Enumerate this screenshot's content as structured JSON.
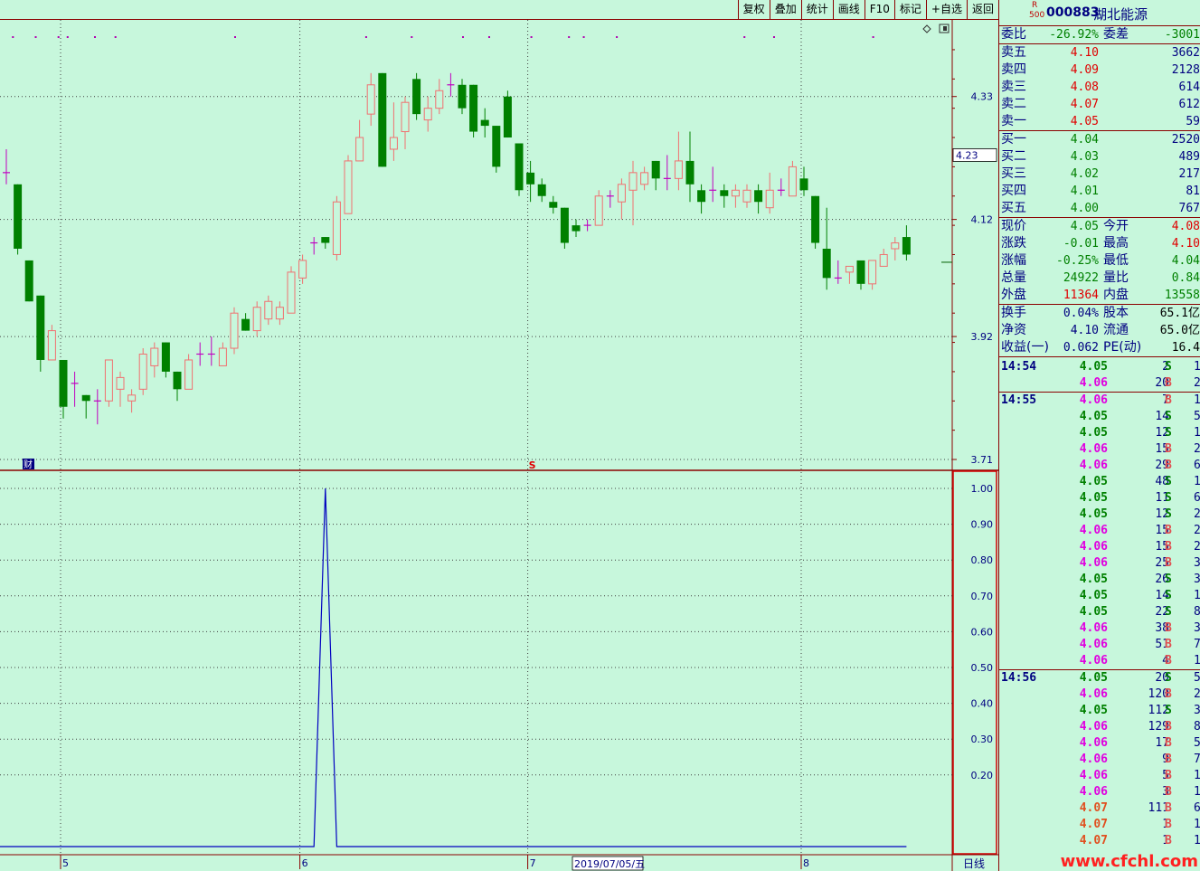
{
  "toolbar": {
    "buttons": [
      "复权",
      "叠加",
      "统计",
      "画线",
      "F10",
      "标记",
      "+自选",
      "返回"
    ]
  },
  "stock": {
    "marker_top": "R",
    "marker_bottom": "500",
    "code": "000883",
    "name": "湖北能源"
  },
  "order_book": {
    "ratio": {
      "label": "委比",
      "value": "-26.92%",
      "label2": "委差",
      "value2": "-3001"
    },
    "sells": [
      {
        "label": "卖五",
        "price": "4.10",
        "vol": "3662"
      },
      {
        "label": "卖四",
        "price": "4.09",
        "vol": "2128"
      },
      {
        "label": "卖三",
        "price": "4.08",
        "vol": "614"
      },
      {
        "label": "卖二",
        "price": "4.07",
        "vol": "612"
      },
      {
        "label": "卖一",
        "price": "4.05",
        "vol": "59"
      }
    ],
    "buys": [
      {
        "label": "买一",
        "price": "4.04",
        "vol": "2520"
      },
      {
        "label": "买二",
        "price": "4.03",
        "vol": "489"
      },
      {
        "label": "买三",
        "price": "4.02",
        "vol": "217"
      },
      {
        "label": "买四",
        "price": "4.01",
        "vol": "81"
      },
      {
        "label": "买五",
        "price": "4.00",
        "vol": "767"
      }
    ]
  },
  "quote": [
    {
      "l1": "现价",
      "v1": "4.05",
      "c1": "green",
      "l2": "今开",
      "v2": "4.08",
      "c2": "red"
    },
    {
      "l1": "涨跌",
      "v1": "-0.01",
      "c1": "green",
      "l2": "最高",
      "v2": "4.10",
      "c2": "red"
    },
    {
      "l1": "涨幅",
      "v1": "-0.25%",
      "c1": "green",
      "l2": "最低",
      "v2": "4.04",
      "c2": "green"
    },
    {
      "l1": "总量",
      "v1": "24922",
      "c1": "green",
      "l2": "量比",
      "v2": "0.84",
      "c2": "green"
    },
    {
      "l1": "外盘",
      "v1": "11364",
      "c1": "red",
      "l2": "内盘",
      "v2": "13558",
      "c2": "green"
    }
  ],
  "finance": [
    {
      "l1": "换手",
      "v1": "0.04%",
      "l2": "股本",
      "v2": "65.1亿"
    },
    {
      "l1": "净资",
      "v1": "4.10",
      "l2": "流通",
      "v2": "65.0亿"
    },
    {
      "l1": "收益(一)",
      "v1": "0.062",
      "l2": "PE(动)",
      "v2": "16.4"
    }
  ],
  "ticks": [
    {
      "time": "14:54",
      "price": "4.05",
      "vol": "2",
      "dir": "S",
      "cnt": "1"
    },
    {
      "time": "",
      "price": "4.06",
      "vol": "20",
      "dir": "B",
      "cnt": "2"
    },
    {
      "time": "14:55",
      "price": "4.06",
      "vol": "7",
      "dir": "B",
      "cnt": "1"
    },
    {
      "time": "",
      "price": "4.05",
      "vol": "14",
      "dir": "S",
      "cnt": "5"
    },
    {
      "time": "",
      "price": "4.05",
      "vol": "12",
      "dir": "S",
      "cnt": "1"
    },
    {
      "time": "",
      "price": "4.06",
      "vol": "15",
      "dir": "B",
      "cnt": "2"
    },
    {
      "time": "",
      "price": "4.06",
      "vol": "29",
      "dir": "B",
      "cnt": "6"
    },
    {
      "time": "",
      "price": "4.05",
      "vol": "48",
      "dir": "S",
      "cnt": "19"
    },
    {
      "time": "",
      "price": "4.05",
      "vol": "11",
      "dir": "S",
      "cnt": "6"
    },
    {
      "time": "",
      "price": "4.05",
      "vol": "12",
      "dir": "S",
      "cnt": "2"
    },
    {
      "time": "",
      "price": "4.06",
      "vol": "15",
      "dir": "B",
      "cnt": "2"
    },
    {
      "time": "",
      "price": "4.06",
      "vol": "15",
      "dir": "B",
      "cnt": "2"
    },
    {
      "time": "",
      "price": "4.06",
      "vol": "25",
      "dir": "B",
      "cnt": "3"
    },
    {
      "time": "",
      "price": "4.05",
      "vol": "26",
      "dir": "S",
      "cnt": "3"
    },
    {
      "time": "",
      "price": "4.05",
      "vol": "14",
      "dir": "S",
      "cnt": "1"
    },
    {
      "time": "",
      "price": "4.05",
      "vol": "22",
      "dir": "S",
      "cnt": "8"
    },
    {
      "time": "",
      "price": "4.06",
      "vol": "38",
      "dir": "B",
      "cnt": "3"
    },
    {
      "time": "",
      "price": "4.06",
      "vol": "51",
      "dir": "B",
      "cnt": "7"
    },
    {
      "time": "",
      "price": "4.06",
      "vol": "4",
      "dir": "B",
      "cnt": "1"
    },
    {
      "time": "14:56",
      "price": "4.05",
      "vol": "20",
      "dir": "S",
      "cnt": "5"
    },
    {
      "time": "",
      "price": "4.06",
      "vol": "120",
      "dir": "B",
      "cnt": "20"
    },
    {
      "time": "",
      "price": "4.05",
      "vol": "112",
      "dir": "S",
      "cnt": "3"
    },
    {
      "time": "",
      "price": "4.06",
      "vol": "129",
      "dir": "B",
      "cnt": "8"
    },
    {
      "time": "",
      "price": "4.06",
      "vol": "17",
      "dir": "B",
      "cnt": "5"
    },
    {
      "time": "",
      "price": "4.06",
      "vol": "9",
      "dir": "B",
      "cnt": "7"
    },
    {
      "time": "",
      "price": "4.06",
      "vol": "5",
      "dir": "B",
      "cnt": "1"
    },
    {
      "time": "",
      "price": "4.06",
      "vol": "3",
      "dir": "B",
      "cnt": "1"
    },
    {
      "time": "",
      "price": "4.07",
      "vol": "111",
      "dir": "B",
      "cnt": "6"
    },
    {
      "time": "",
      "price": "4.07",
      "vol": "1",
      "dir": "B",
      "cnt": "1"
    },
    {
      "time": "",
      "price": "4.07",
      "vol": "1",
      "dir": "B",
      "cnt": "1"
    }
  ],
  "colors": {
    "up": "#f07070",
    "down": "#008000",
    "doji": "#c000c0",
    "indicator": "#0000c0",
    "grid": "#404040",
    "frame": "#8b0000",
    "cursor_box": "#d00000"
  },
  "chart_data": {
    "type": "candlestick",
    "price_axis": {
      "ticks": [
        "4.33",
        "4.12",
        "3.92",
        "3.71"
      ],
      "ylim": [
        3.71,
        4.43
      ],
      "current_label": "4.23"
    },
    "indicator_axis": {
      "ticks": [
        "1.00",
        "0.90",
        "0.80",
        "0.70",
        "0.60",
        "0.50",
        "0.40",
        "0.30",
        "0.20"
      ],
      "ylim": [
        0.0,
        1.0
      ]
    },
    "x_labels": [
      "5",
      "6",
      "7",
      "2019/07/05/五",
      "8"
    ],
    "period_label": "日线",
    "markers": [
      "财",
      "S"
    ],
    "candles": [
      {
        "o": 4.2,
        "h": 4.24,
        "l": 4.18,
        "c": 4.2
      },
      {
        "o": 4.18,
        "h": 4.18,
        "l": 4.06,
        "c": 4.07
      },
      {
        "o": 4.05,
        "h": 4.05,
        "l": 3.98,
        "c": 3.98
      },
      {
        "o": 3.99,
        "h": 3.99,
        "l": 3.86,
        "c": 3.88
      },
      {
        "o": 3.88,
        "h": 3.94,
        "l": 3.88,
        "c": 3.93
      },
      {
        "o": 3.88,
        "h": 3.88,
        "l": 3.78,
        "c": 3.8
      },
      {
        "o": 3.84,
        "h": 3.86,
        "l": 3.8,
        "c": 3.84
      },
      {
        "o": 3.82,
        "h": 3.82,
        "l": 3.78,
        "c": 3.81
      },
      {
        "o": 3.81,
        "h": 3.83,
        "l": 3.77,
        "c": 3.81
      },
      {
        "o": 3.81,
        "h": 3.88,
        "l": 3.8,
        "c": 3.88
      },
      {
        "o": 3.83,
        "h": 3.86,
        "l": 3.8,
        "c": 3.85
      },
      {
        "o": 3.81,
        "h": 3.83,
        "l": 3.79,
        "c": 3.82
      },
      {
        "o": 3.83,
        "h": 3.9,
        "l": 3.82,
        "c": 3.89
      },
      {
        "o": 3.87,
        "h": 3.91,
        "l": 3.85,
        "c": 3.9
      },
      {
        "o": 3.91,
        "h": 3.91,
        "l": 3.85,
        "c": 3.86
      },
      {
        "o": 3.86,
        "h": 3.86,
        "l": 3.81,
        "c": 3.83
      },
      {
        "o": 3.83,
        "h": 3.89,
        "l": 3.83,
        "c": 3.88
      },
      {
        "o": 3.89,
        "h": 3.91,
        "l": 3.87,
        "c": 3.89
      },
      {
        "o": 3.89,
        "h": 3.92,
        "l": 3.87,
        "c": 3.89
      },
      {
        "o": 3.87,
        "h": 3.91,
        "l": 3.87,
        "c": 3.9
      },
      {
        "o": 3.9,
        "h": 3.97,
        "l": 3.89,
        "c": 3.96
      },
      {
        "o": 3.95,
        "h": 3.96,
        "l": 3.93,
        "c": 3.93
      },
      {
        "o": 3.93,
        "h": 3.98,
        "l": 3.92,
        "c": 3.97
      },
      {
        "o": 3.95,
        "h": 3.99,
        "l": 3.94,
        "c": 3.98
      },
      {
        "o": 3.95,
        "h": 3.98,
        "l": 3.94,
        "c": 3.97
      },
      {
        "o": 3.96,
        "h": 4.04,
        "l": 3.96,
        "c": 4.03
      },
      {
        "o": 4.02,
        "h": 4.06,
        "l": 4.01,
        "c": 4.05
      },
      {
        "o": 4.08,
        "h": 4.09,
        "l": 4.06,
        "c": 4.08
      },
      {
        "o": 4.09,
        "h": 4.09,
        "l": 4.07,
        "c": 4.08
      },
      {
        "o": 4.06,
        "h": 4.16,
        "l": 4.05,
        "c": 4.15
      },
      {
        "o": 4.13,
        "h": 4.23,
        "l": 4.13,
        "c": 4.22
      },
      {
        "o": 4.22,
        "h": 4.29,
        "l": 4.22,
        "c": 4.26
      },
      {
        "o": 4.3,
        "h": 4.37,
        "l": 4.28,
        "c": 4.35
      },
      {
        "o": 4.37,
        "h": 4.37,
        "l": 4.21,
        "c": 4.21
      },
      {
        "o": 4.24,
        "h": 4.32,
        "l": 4.22,
        "c": 4.26
      },
      {
        "o": 4.27,
        "h": 4.33,
        "l": 4.24,
        "c": 4.32
      },
      {
        "o": 4.36,
        "h": 4.37,
        "l": 4.29,
        "c": 4.3
      },
      {
        "o": 4.29,
        "h": 4.33,
        "l": 4.27,
        "c": 4.31
      },
      {
        "o": 4.31,
        "h": 4.36,
        "l": 4.3,
        "c": 4.34
      },
      {
        "o": 4.35,
        "h": 4.37,
        "l": 4.33,
        "c": 4.35
      },
      {
        "o": 4.35,
        "h": 4.36,
        "l": 4.3,
        "c": 4.31
      },
      {
        "o": 4.35,
        "h": 4.35,
        "l": 4.26,
        "c": 4.27
      },
      {
        "o": 4.29,
        "h": 4.31,
        "l": 4.26,
        "c": 4.28
      },
      {
        "o": 4.28,
        "h": 4.28,
        "l": 4.2,
        "c": 4.21
      },
      {
        "o": 4.33,
        "h": 4.34,
        "l": 4.26,
        "c": 4.26
      },
      {
        "o": 4.25,
        "h": 4.25,
        "l": 4.16,
        "c": 4.17
      },
      {
        "o": 4.2,
        "h": 4.22,
        "l": 4.15,
        "c": 4.18
      },
      {
        "o": 4.18,
        "h": 4.19,
        "l": 4.15,
        "c": 4.16
      },
      {
        "o": 4.15,
        "h": 4.16,
        "l": 4.13,
        "c": 4.14
      },
      {
        "o": 4.14,
        "h": 4.14,
        "l": 4.07,
        "c": 4.08
      },
      {
        "o": 4.11,
        "h": 4.12,
        "l": 4.09,
        "c": 4.1
      },
      {
        "o": 4.11,
        "h": 4.12,
        "l": 4.1,
        "c": 4.11
      },
      {
        "o": 4.11,
        "h": 4.17,
        "l": 4.11,
        "c": 4.16
      },
      {
        "o": 4.16,
        "h": 4.17,
        "l": 4.14,
        "c": 4.16
      },
      {
        "o": 4.15,
        "h": 4.19,
        "l": 4.12,
        "c": 4.18
      },
      {
        "o": 4.17,
        "h": 4.22,
        "l": 4.11,
        "c": 4.2
      },
      {
        "o": 4.18,
        "h": 4.21,
        "l": 4.17,
        "c": 4.2
      },
      {
        "o": 4.22,
        "h": 4.22,
        "l": 4.17,
        "c": 4.19
      },
      {
        "o": 4.19,
        "h": 4.23,
        "l": 4.17,
        "c": 4.19
      },
      {
        "o": 4.19,
        "h": 4.27,
        "l": 4.17,
        "c": 4.22
      },
      {
        "o": 4.22,
        "h": 4.27,
        "l": 4.15,
        "c": 4.18
      },
      {
        "o": 4.17,
        "h": 4.18,
        "l": 4.13,
        "c": 4.15
      },
      {
        "o": 4.17,
        "h": 4.21,
        "l": 4.15,
        "c": 4.17
      },
      {
        "o": 4.17,
        "h": 4.18,
        "l": 4.14,
        "c": 4.16
      },
      {
        "o": 4.16,
        "h": 4.18,
        "l": 4.14,
        "c": 4.17
      },
      {
        "o": 4.15,
        "h": 4.18,
        "l": 4.14,
        "c": 4.17
      },
      {
        "o": 4.17,
        "h": 4.18,
        "l": 4.13,
        "c": 4.15
      },
      {
        "o": 4.14,
        "h": 4.2,
        "l": 4.13,
        "c": 4.17
      },
      {
        "o": 4.17,
        "h": 4.19,
        "l": 4.16,
        "c": 4.17
      },
      {
        "o": 4.16,
        "h": 4.22,
        "l": 4.16,
        "c": 4.21
      },
      {
        "o": 4.19,
        "h": 4.21,
        "l": 4.16,
        "c": 4.17
      },
      {
        "o": 4.16,
        "h": 4.16,
        "l": 4.07,
        "c": 4.08
      },
      {
        "o": 4.07,
        "h": 4.14,
        "l": 4.0,
        "c": 4.02
      },
      {
        "o": 4.02,
        "h": 4.05,
        "l": 4.01,
        "c": 4.02
      },
      {
        "o": 4.03,
        "h": 4.04,
        "l": 4.01,
        "c": 4.04
      },
      {
        "o": 4.05,
        "h": 4.05,
        "l": 4.0,
        "c": 4.01
      },
      {
        "o": 4.01,
        "h": 4.05,
        "l": 4.0,
        "c": 4.05
      },
      {
        "o": 4.04,
        "h": 4.07,
        "l": 4.04,
        "c": 4.06
      },
      {
        "o": 4.07,
        "h": 4.09,
        "l": 4.05,
        "c": 4.08
      },
      {
        "o": 4.09,
        "h": 4.11,
        "l": 4.05,
        "c": 4.06
      }
    ],
    "indicator_series": {
      "baseline": 0.0,
      "peak_value": 1.0,
      "peak_index": 28
    }
  }
}
